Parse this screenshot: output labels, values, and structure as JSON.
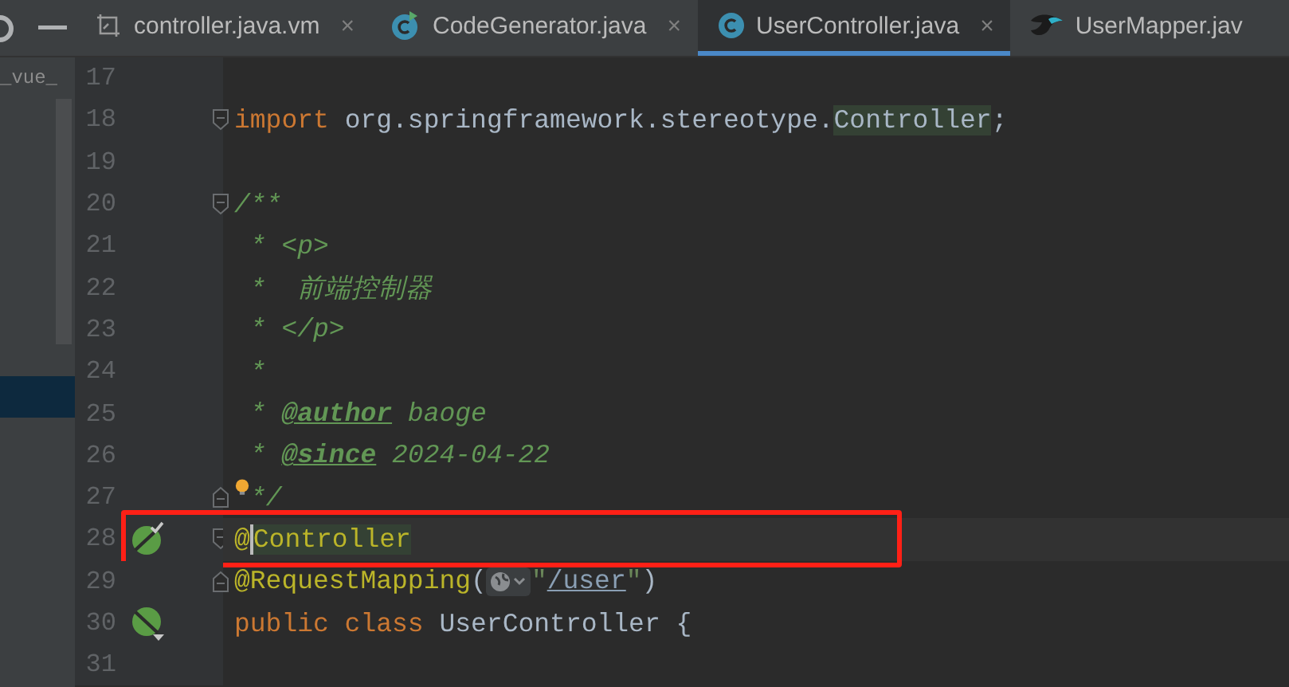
{
  "tabs": [
    {
      "label": "controller.java.vm",
      "kind": "template",
      "close": "×",
      "selected": false
    },
    {
      "label": "CodeGenerator.java",
      "kind": "runnable-class",
      "close": "×",
      "selected": false
    },
    {
      "label": "UserController.java",
      "kind": "class",
      "close": "×",
      "selected": true
    },
    {
      "label": "UserMapper.jav",
      "kind": "mapper",
      "selected": false
    }
  ],
  "sidebar": {
    "text": "_vue_"
  },
  "lines": [
    {
      "number": "17"
    },
    {
      "number": "18",
      "fold": {
        "kind": "start"
      },
      "tokens": [
        {
          "kind": "keyword",
          "text": "import"
        },
        {
          "kind": "plain",
          "text": " org.springframework.stereotype."
        },
        {
          "kind": "ref",
          "text": "Controller"
        },
        {
          "kind": "plain",
          "text": ";"
        }
      ]
    },
    {
      "number": "19"
    },
    {
      "number": "20",
      "fold": {
        "kind": "start"
      },
      "tokens": [
        {
          "kind": "comment",
          "text": "/**"
        }
      ]
    },
    {
      "number": "21",
      "tokens": [
        {
          "kind": "comment",
          "text": " * <p>"
        }
      ]
    },
    {
      "number": "22",
      "tokens": [
        {
          "kind": "comment",
          "text": " *  前端控制器"
        }
      ]
    },
    {
      "number": "23",
      "tokens": [
        {
          "kind": "comment",
          "text": " * </p>"
        }
      ]
    },
    {
      "number": "24",
      "tokens": [
        {
          "kind": "comment",
          "text": " *"
        }
      ]
    },
    {
      "number": "25",
      "tokens": [
        {
          "kind": "comment",
          "text": " * "
        },
        {
          "kind": "doctag",
          "text": "@author"
        },
        {
          "kind": "comment",
          "text": " baoge"
        }
      ]
    },
    {
      "number": "26",
      "tokens": [
        {
          "kind": "comment",
          "text": " * "
        },
        {
          "kind": "doctag",
          "text": "@since"
        },
        {
          "kind": "comment",
          "text": " 2024-04-22"
        }
      ]
    },
    {
      "number": "27",
      "fold": {
        "kind": "end"
      },
      "bulb": true,
      "tokens": [
        {
          "kind": "comment",
          "text": "*/"
        }
      ]
    },
    {
      "number": "28",
      "fold": {
        "kind": "start"
      },
      "gutter": {
        "kind": "bean-check"
      },
      "current": true,
      "marked": true,
      "tokens": [
        {
          "kind": "annotation",
          "text": "@"
        },
        {
          "kind": "caret"
        },
        {
          "kind": "annotation-ref",
          "text": "Controller"
        }
      ]
    },
    {
      "number": "29",
      "fold": {
        "kind": "end"
      },
      "tokens": [
        {
          "kind": "annotation",
          "text": "@RequestMapping"
        },
        {
          "kind": "plain",
          "text": "("
        },
        {
          "kind": "globe-inlay"
        },
        {
          "kind": "string",
          "text": "\""
        },
        {
          "kind": "link",
          "text": "/user"
        },
        {
          "kind": "string",
          "text": "\""
        },
        {
          "kind": "plain",
          "text": ")"
        }
      ]
    },
    {
      "number": "30",
      "gutter": {
        "kind": "bean-arrow"
      },
      "tokens": [
        {
          "kind": "keyword",
          "text": "public class"
        },
        {
          "kind": "plain",
          "text": " UserController {"
        }
      ]
    },
    {
      "number": "31"
    }
  ]
}
